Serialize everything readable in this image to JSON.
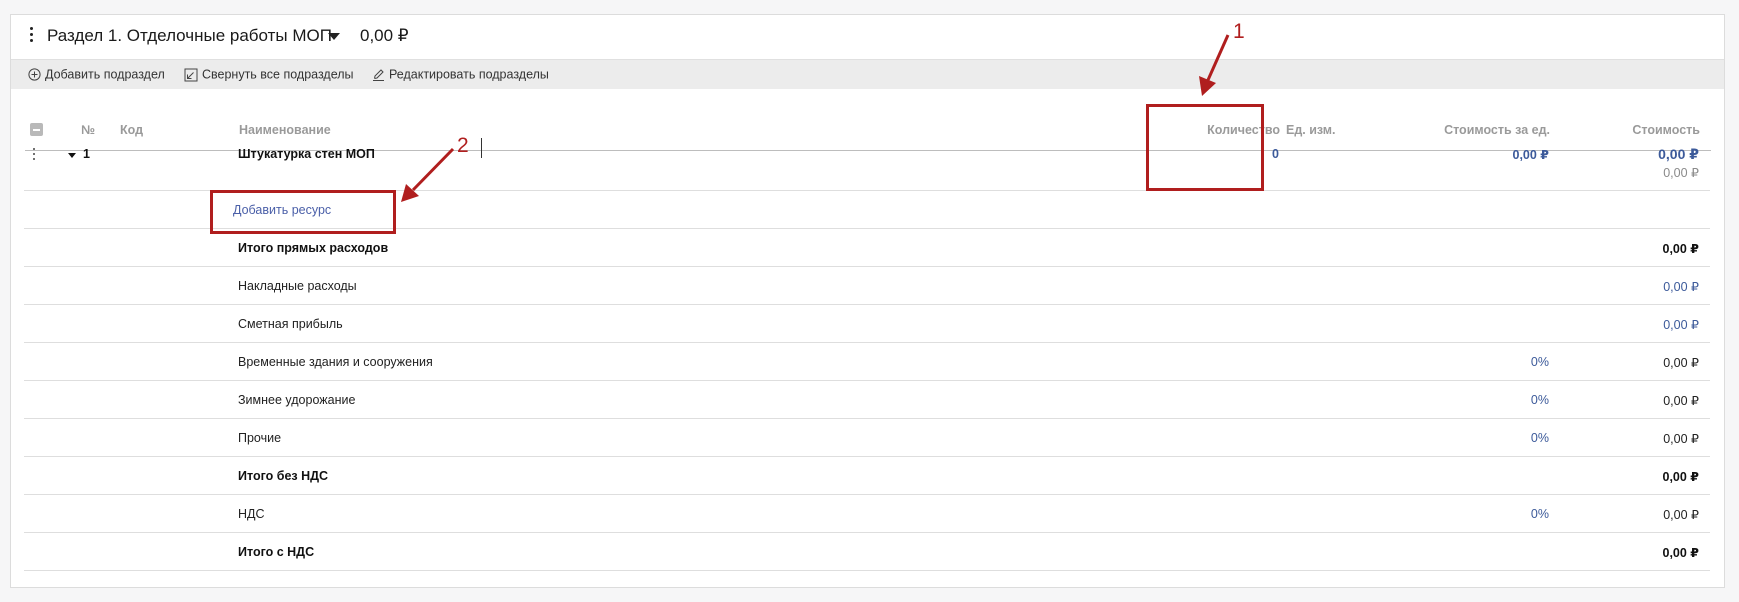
{
  "section": {
    "title": "Раздел 1. Отделочные работы МОП",
    "total": "0,00 ₽"
  },
  "toolbar": {
    "add_subsection": "Добавить подраздел",
    "collapse_all": "Свернуть все подразделы",
    "edit_subsections": "Редактировать подразделы"
  },
  "columns": {
    "num": "№",
    "code": "Код",
    "name": "Наименование",
    "quantity": "Количество",
    "unit": "Ед. изм.",
    "unit_cost": "Стоимость за ед.",
    "cost": "Стоимость"
  },
  "item": {
    "num": "1",
    "name": "Штукатурка стен МОП",
    "quantity": "0",
    "unit_cost": "0,00 ₽",
    "cost": "0,00 ₽",
    "cost_sub": "0,00 ₽"
  },
  "add_resource_label": "Добавить ресурс",
  "totals": [
    {
      "name": "Итого прямых расходов",
      "bold": true,
      "percent": "",
      "value": "0,00 ₽",
      "value_style": "bold"
    },
    {
      "name": "Накладные расходы",
      "bold": false,
      "percent": "",
      "value": "0,00 ₽",
      "value_style": "blue"
    },
    {
      "name": "Сметная прибыль",
      "bold": false,
      "percent": "",
      "value": "0,00 ₽",
      "value_style": "blue"
    },
    {
      "name": "Временные здания и сооружения",
      "bold": false,
      "percent": "0%",
      "value": "0,00 ₽",
      "value_style": "normal"
    },
    {
      "name": "Зимнее удорожание",
      "bold": false,
      "percent": "0%",
      "value": "0,00 ₽",
      "value_style": "normal"
    },
    {
      "name": "Прочие",
      "bold": false,
      "percent": "0%",
      "value": "0,00 ₽",
      "value_style": "normal"
    },
    {
      "name": "Итого без НДС",
      "bold": true,
      "percent": "",
      "value": "0,00 ₽",
      "value_style": "bold"
    },
    {
      "name": "НДС",
      "bold": false,
      "percent": "0%",
      "value": "0,00 ₽",
      "value_style": "normal"
    },
    {
      "name": "Итого с НДС",
      "bold": true,
      "percent": "",
      "value": "0,00 ₽",
      "value_style": "bold"
    }
  ],
  "annotations": {
    "label_1": "1",
    "label_2": "2",
    "color": "#b01e1e"
  },
  "colors": {
    "link_blue": "#3c5a9a",
    "toolbar_bg": "#ececec"
  }
}
